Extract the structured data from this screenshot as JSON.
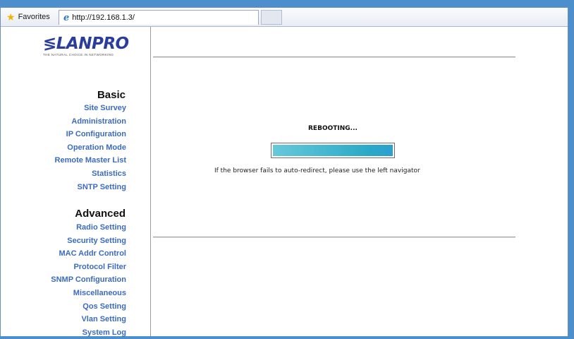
{
  "browser": {
    "favorites_label": "Favorites",
    "tab_url": "http://192.168.1.3/"
  },
  "logo": {
    "brand": "LANPRO",
    "tagline": "THE NATURAL CHOICE IN NETWORKING"
  },
  "sidebar": {
    "basic": {
      "heading": "Basic",
      "items": [
        "Site Survey",
        "Administration",
        "IP Configuration",
        "Operation Mode",
        "Remote Master List",
        "Statistics",
        "SNTP Setting"
      ]
    },
    "advanced": {
      "heading": "Advanced",
      "items": [
        "Radio Setting",
        "Security Setting",
        "MAC Addr Control",
        "Protocol Filter",
        "SNMP Configuration",
        "Miscellaneous",
        "Qos Setting",
        "Vlan Setting",
        "System Log"
      ]
    }
  },
  "main": {
    "status": "REBOOTING...",
    "progress_percent": 100,
    "notice": "If the browser fails to auto-redirect, please use the left navigator"
  }
}
